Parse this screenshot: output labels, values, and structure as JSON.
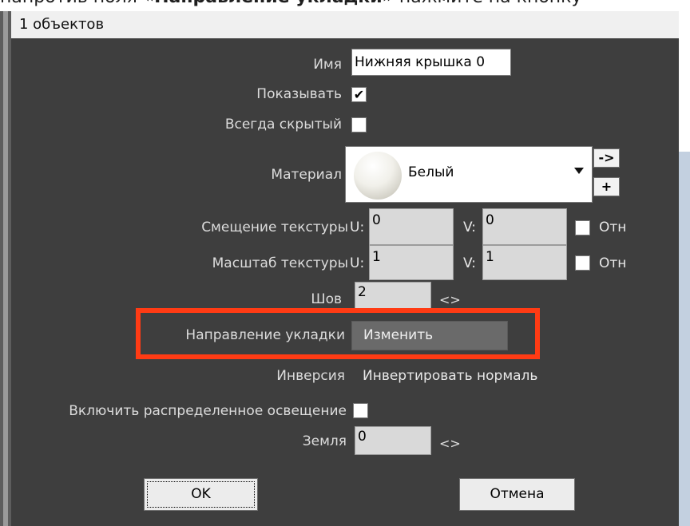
{
  "document": {
    "text_before": "напротив поля ",
    "text_bold": "«Направление укладки»",
    "text_after": " нажмите на кнопку"
  },
  "dialog": {
    "title": "1 объектов",
    "fields": {
      "name_label": "Имя",
      "name_value": "Нижняя крышка 0",
      "show_label": "Показывать",
      "show_checked": "✔",
      "always_hidden_label": "Всегда скрытый",
      "material_label": "Материал",
      "material_value": "Белый",
      "material_goto_button": "->",
      "material_add_button": "+",
      "tex_offset_label": "Смещение текстуры",
      "tex_offset_u_label": "U:",
      "tex_offset_u": "0",
      "tex_offset_v_label": "V:",
      "tex_offset_v": "0",
      "tex_offset_rel_label": "Отн",
      "tex_scale_label": "Масштаб текстуры",
      "tex_scale_u_label": "U:",
      "tex_scale_u": "1",
      "tex_scale_v_label": "V:",
      "tex_scale_v": "1",
      "tex_scale_rel_label": "Отн",
      "seam_label": "Шов",
      "seam_value": "2",
      "seam_arrows": "<>",
      "layout_direction_label": "Направление укладки",
      "layout_direction_button": "Изменить",
      "inversion_label": "Инверсия",
      "inversion_value": "Инвертировать нормаль",
      "distributed_light_label": "Включить распределенное освещение",
      "ground_label": "Земля",
      "ground_value": "0",
      "ground_arrows": "<>"
    },
    "buttons": {
      "ok": "OK",
      "cancel": "Отмена"
    }
  },
  "colors": {
    "dialog_background": "#3e3e3e",
    "highlight": "#ff3b14"
  }
}
